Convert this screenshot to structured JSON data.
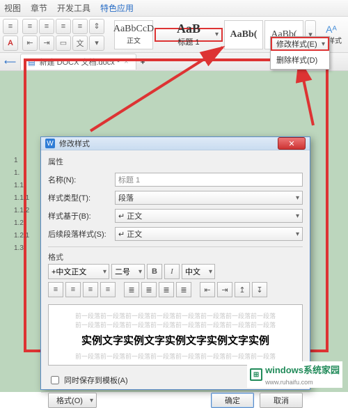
{
  "tabs": {
    "view": "视图",
    "chapter": "章节",
    "dev": "开发工具",
    "special": "特色应用"
  },
  "ribbon": {
    "styles": [
      {
        "preview": "AaBbCcD",
        "label": "正文"
      },
      {
        "preview": "AaB",
        "label": "标题 1"
      },
      {
        "preview": "AaBb(",
        "label": ""
      },
      {
        "preview": "AaBb(",
        "label": ""
      }
    ],
    "newstyle": "新样式"
  },
  "ctxmenu": {
    "modify": "修改样式(E)",
    "delete": "删除样式(D)"
  },
  "doctab": {
    "name": "新建 DOCX 文档.docx *",
    "plus": "+"
  },
  "outline": [
    "1",
    "1.",
    "1.1",
    "1.1.1",
    "1.1.2",
    "1.2",
    "1.2.1",
    "1.3"
  ],
  "dialog": {
    "title": "修改样式",
    "group_props": "属性",
    "name_label": "名称(N):",
    "name_value": "标题 1",
    "type_label": "样式类型(T):",
    "type_value": "段落",
    "based_label": "样式基于(B):",
    "based_value": "↵ 正文",
    "next_label": "后续段落样式(S):",
    "next_value": "↵ 正文",
    "group_format": "格式",
    "font": "+中文正文",
    "size": "二号",
    "lang": "中文",
    "bold": "B",
    "italic": "I",
    "preview_filler": "前一段落前一段落前一段落前一段落前一段落前一段落前一段落前一段落",
    "preview_sample": "实例文字实例文字实例文字实例文字实例",
    "save_template": "同时保存到模板(A)",
    "format_btn": "格式(O)",
    "ok": "确定",
    "cancel": "取消"
  },
  "watermark": {
    "text": "windows系统家园",
    "url": "www.ruhaifu.com"
  }
}
